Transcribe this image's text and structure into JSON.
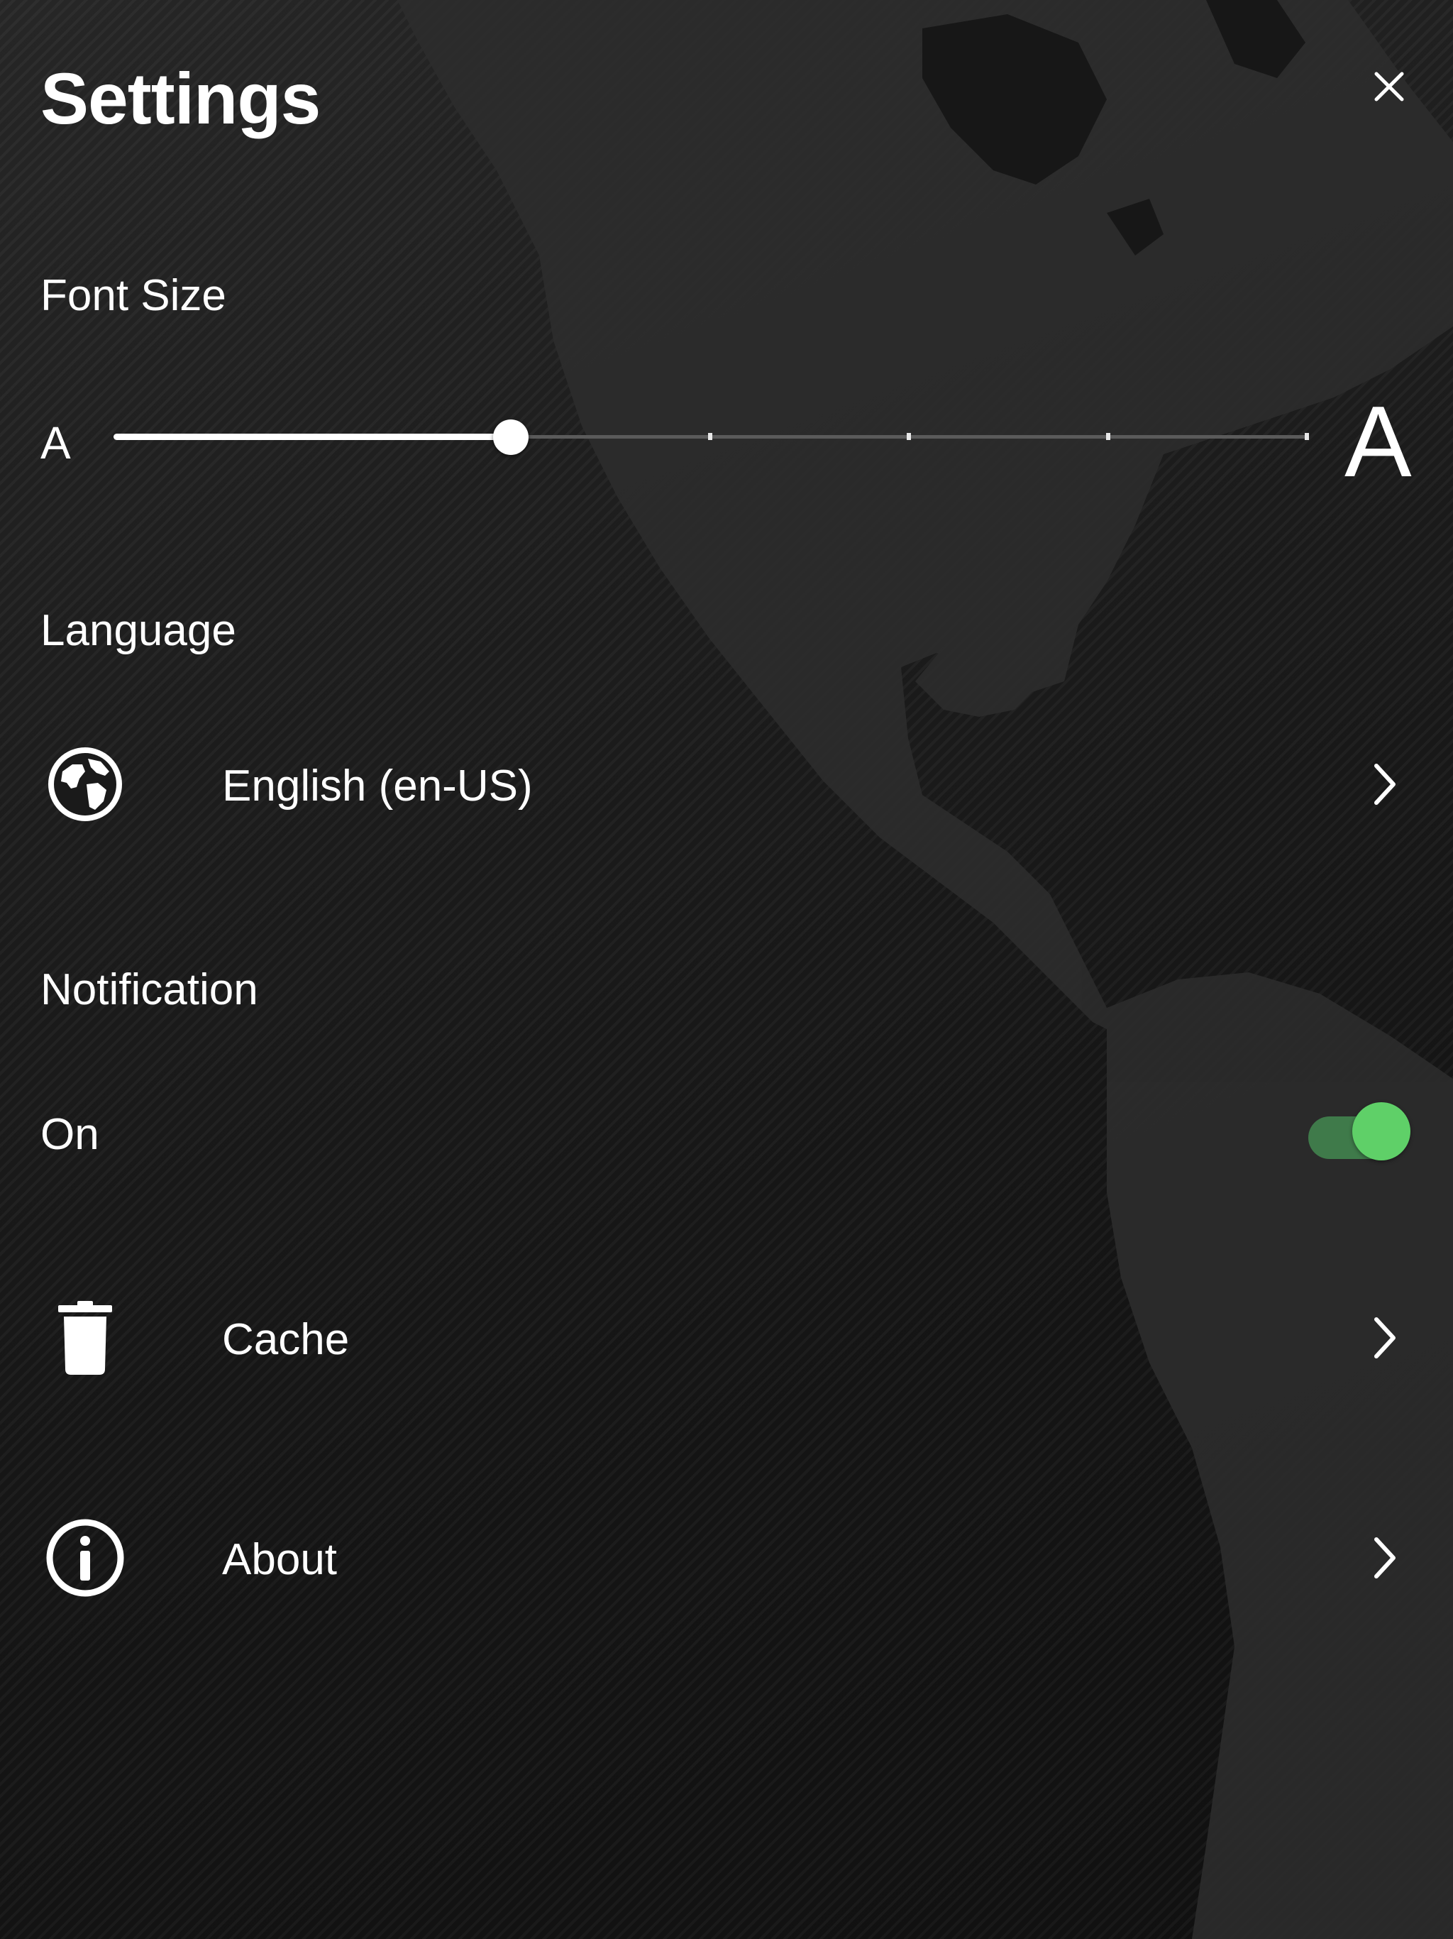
{
  "header": {
    "title": "Settings",
    "close_icon": "close-icon"
  },
  "font_size": {
    "label": "Font Size",
    "small_marker": "A",
    "large_marker": "A",
    "steps": 8,
    "selected_step": 3,
    "level_fraction": 0.333
  },
  "language": {
    "label": "Language",
    "icon": "globe-icon",
    "value": "English (en-US)"
  },
  "notification": {
    "label": "Notification",
    "state_label": "On",
    "enabled": true,
    "toggle_on_color": "#5fd068"
  },
  "cache": {
    "icon": "trash-icon",
    "label": "Cache"
  },
  "about": {
    "icon": "info-icon",
    "label": "About"
  }
}
